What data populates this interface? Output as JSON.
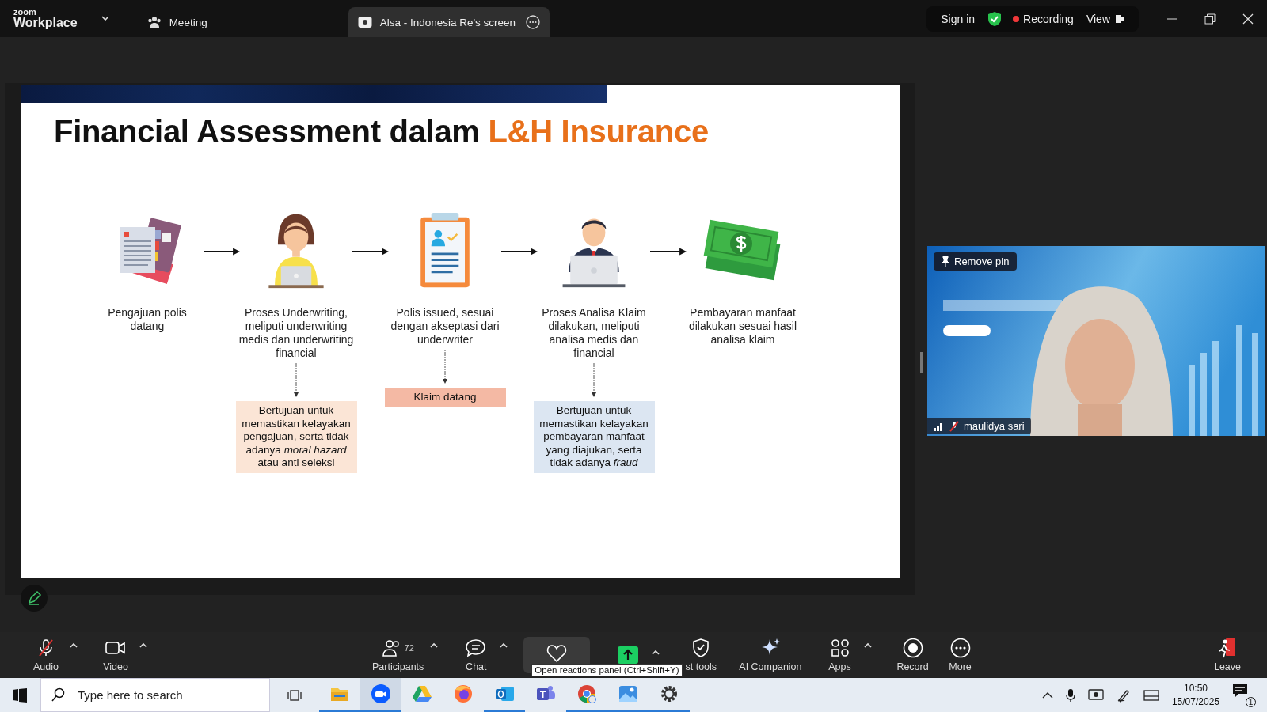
{
  "app_bar": {
    "logo_top": "zoom",
    "logo_bottom": "Workplace",
    "tabs": [
      {
        "kind": "meeting",
        "label": "Meeting",
        "selected": false
      },
      {
        "kind": "screen",
        "label": "Alsa - Indonesia Re's screen",
        "selected": true
      }
    ],
    "sign_in": "Sign in",
    "recording": "Recording",
    "view": "View"
  },
  "slide": {
    "title": "Financial Assessment dalam",
    "title_highlight": "L&H Insurance",
    "steps": [
      {
        "kind": "documents",
        "caption": "Pengajuan polis datang"
      },
      {
        "kind": "woman",
        "caption": "Proses Underwriting, meliputi underwriting medis dan underwriting financial",
        "note": {
          "text": "Bertujuan untuk memastikan kelayakan pengajuan, serta tidak adanya *moral hazard* atau anti seleksi",
          "color": "#fbe5d6"
        }
      },
      {
        "kind": "clipboard",
        "caption": "Polis issued, sesuai dengan akseptasi dari underwriter",
        "note": {
          "text": "Klaim datang",
          "color": "#f4b9a4"
        }
      },
      {
        "kind": "man",
        "caption": "Proses Analisa Klaim dilakukan, meliputi analisa medis dan financial",
        "note": {
          "text": "Bertujuan untuk memastikan kelayakan pembayaran manfaat yang diajukan, serta tidak adanya *fraud*",
          "color": "#dce6f2"
        }
      },
      {
        "kind": "money",
        "caption": "Pembayaran manfaat dilakukan sesuai hasil analisa klaim"
      }
    ]
  },
  "video_tile": {
    "pin_button": "Remove pin",
    "participant": "maulidya sari",
    "muted": true
  },
  "toolbar": {
    "items": [
      {
        "kind": "audio",
        "label": "Audio",
        "caret": true,
        "muted": true
      },
      {
        "kind": "video",
        "label": "Video",
        "caret": true
      },
      {
        "kind": "participants",
        "label": "Participants",
        "count": "72",
        "caret": true
      },
      {
        "kind": "chat",
        "label": "Chat",
        "caret": true
      },
      {
        "kind": "reactions",
        "tooltip": "Open reactions panel (Ctrl+Shift+Y)"
      },
      {
        "kind": "share",
        "caret": true
      },
      {
        "kind": "host",
        "label": "st tools"
      },
      {
        "kind": "ai",
        "label": "AI Companion"
      },
      {
        "kind": "apps",
        "label": "Apps",
        "caret": true
      },
      {
        "kind": "record",
        "label": "Record"
      },
      {
        "kind": "more",
        "label": "More"
      }
    ],
    "leave": "Leave"
  },
  "taskbar": {
    "search_placeholder": "Type here to search",
    "apps": [
      {
        "kind": "explorer",
        "running": true,
        "selected": false
      },
      {
        "kind": "zoom",
        "running": true,
        "selected": true
      },
      {
        "kind": "drive",
        "running": false,
        "selected": false
      },
      {
        "kind": "firefox",
        "running": false,
        "selected": false
      },
      {
        "kind": "outlook",
        "running": true,
        "selected": false
      },
      {
        "kind": "teams",
        "running": false,
        "selected": false
      },
      {
        "kind": "chrome",
        "running": true,
        "selected": false
      },
      {
        "kind": "photos",
        "running": true,
        "selected": false
      },
      {
        "kind": "settings",
        "running": true,
        "selected": false
      }
    ],
    "time": "10:50",
    "date": "15/07/2025",
    "notifications": "1"
  }
}
